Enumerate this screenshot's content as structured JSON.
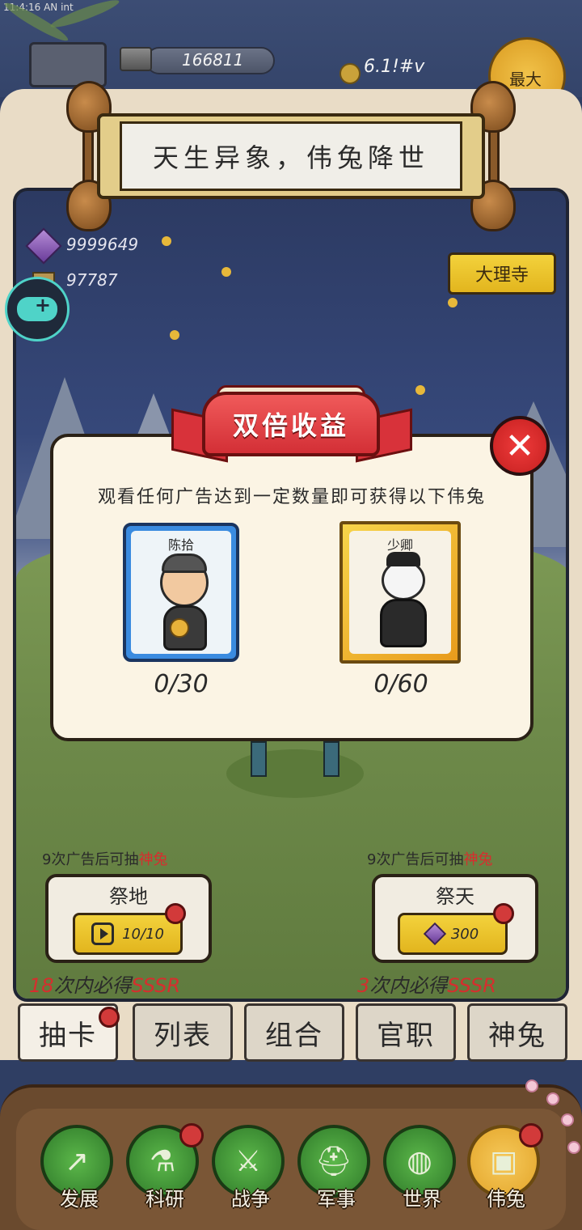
{
  "status": {
    "time": "11:4:16 AN int"
  },
  "top_bar": {
    "silver": "166811",
    "coin": "6.1!#v",
    "max_label": "最大"
  },
  "title": "天生异象，伟兔降世",
  "resources": {
    "gems": "9999649",
    "gold": "97787"
  },
  "side_button": {
    "label": "大理寺"
  },
  "popup": {
    "title": "双倍收益",
    "message": "观看任何广告达到一定数量即可获得以下伟兔",
    "cards": [
      {
        "name": "陈拾",
        "progress": "0/30",
        "rarity_color": "#3a8be0"
      },
      {
        "name": "少卿",
        "progress": "0/60",
        "rarity_color": "#f0b733"
      }
    ]
  },
  "draw": {
    "left": {
      "hint_prefix": "9次广告后可抽",
      "hint_red": "神兔",
      "title": "祭地",
      "button": "10/10",
      "guarantee_num": "18",
      "guarantee_text": "次内必得",
      "guarantee_rank": "SSSR"
    },
    "right": {
      "hint_prefix": "9次广告后可抽",
      "hint_red": "神兔",
      "title": "祭天",
      "button": "300",
      "guarantee_num": "3",
      "guarantee_text": "次内必得",
      "guarantee_rank": "SSSR"
    }
  },
  "subtabs": [
    "抽卡",
    "列表",
    "组合",
    "官职",
    "神兔"
  ],
  "nav": [
    {
      "label": "发展",
      "icon": "arrow-up-icon"
    },
    {
      "label": "科研",
      "icon": "flask-icon"
    },
    {
      "label": "战争",
      "icon": "swords-icon"
    },
    {
      "label": "军事",
      "icon": "helmet-icon"
    },
    {
      "label": "世界",
      "icon": "globe-icon"
    },
    {
      "label": "伟兔",
      "icon": "rabbit-card-icon"
    }
  ],
  "colors": {
    "accent_red": "#d62e2e",
    "button_yellow": "#f3d23c",
    "nav_green": "#3f9a36"
  }
}
